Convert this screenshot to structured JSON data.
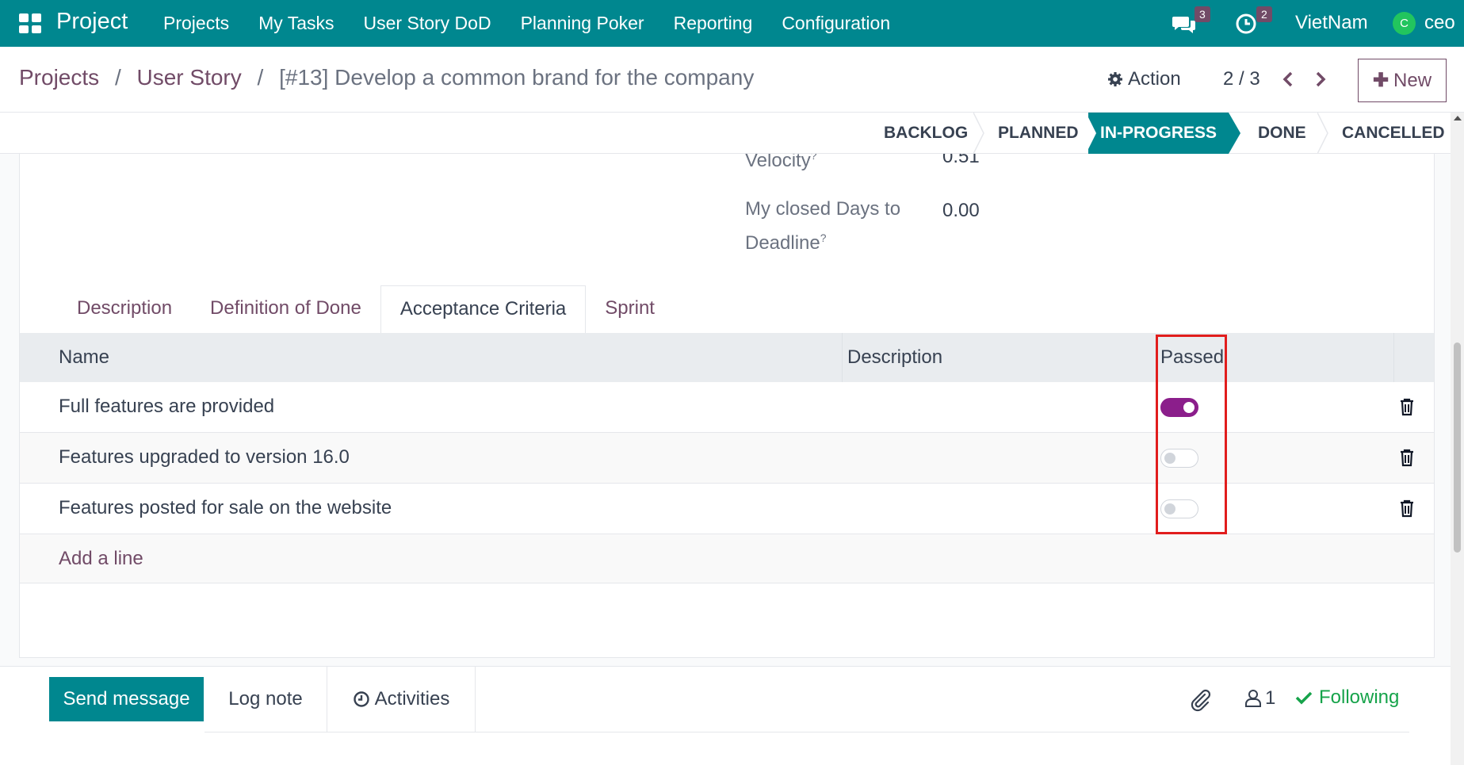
{
  "navbar": {
    "brand": "Project",
    "menu": [
      "Projects",
      "My Tasks",
      "User Story DoD",
      "Planning Poker",
      "Reporting",
      "Configuration"
    ],
    "messages_badge": "3",
    "activities_badge": "2",
    "company": "VietNam",
    "avatar_letter": "C",
    "user": "ceo"
  },
  "breadcrumb": {
    "projects": "Projects",
    "sep1": "/",
    "user_story": "User Story",
    "sep2": "/",
    "current": "[#13] Develop a common brand for the company"
  },
  "control": {
    "action_label": "Action",
    "pager": "2 / 3",
    "new_label": "New"
  },
  "statusbar": {
    "stages": [
      "BACKLOG",
      "PLANNED",
      "IN-PROGRESS",
      "DONE",
      "CANCELLED"
    ],
    "active": "IN-PROGRESS"
  },
  "fields": {
    "velocity_label": "Velocity",
    "velocity_value": "0.51",
    "closed_days_label_1": "My closed Days to",
    "closed_days_label_2": "Deadline",
    "help_mark": "?",
    "closed_days_value": "0.00"
  },
  "tabs": [
    "Description",
    "Definition of Done",
    "Acceptance Criteria",
    "Sprint"
  ],
  "active_tab": "Acceptance Criteria",
  "table": {
    "columns": [
      "Name",
      "Description",
      "Passed"
    ],
    "rows": [
      {
        "name": "Full features are provided",
        "passed": true
      },
      {
        "name": "Features upgraded to version 16.0",
        "passed": false
      },
      {
        "name": "Features posted for sale on the website",
        "passed": false
      }
    ],
    "add_line": "Add a line"
  },
  "chatter": {
    "send_message": "Send message",
    "log_note": "Log note",
    "activities": "Activities",
    "followers_count": "1",
    "following": "Following"
  },
  "colors": {
    "teal": "#00878f",
    "brand_purple": "#714b67",
    "toggle_on": "#8b1e8b",
    "highlight": "#e11d1d",
    "following_green": "#16a34a"
  }
}
